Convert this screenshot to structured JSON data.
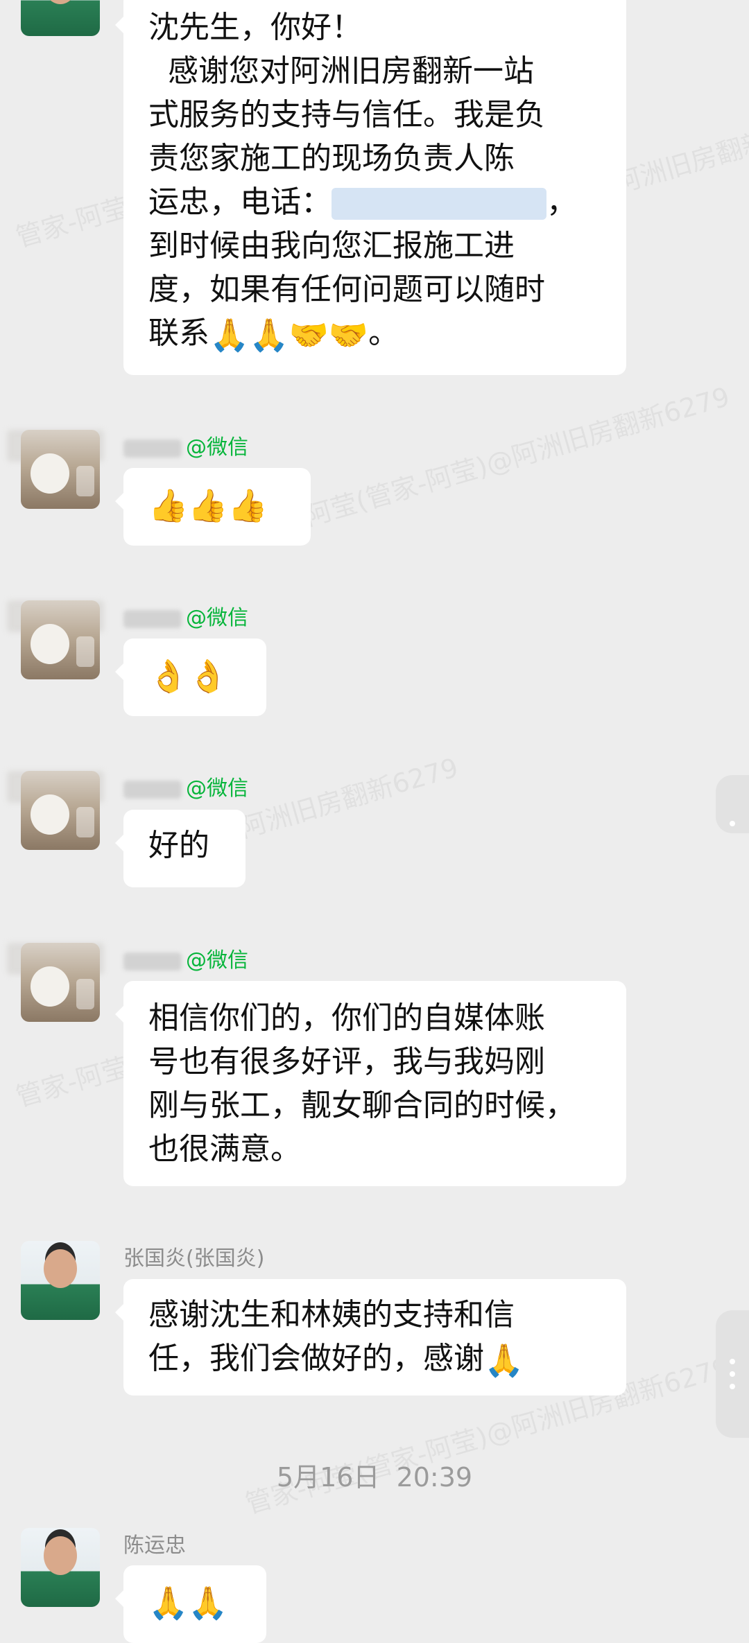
{
  "watermark_text": "管家-阿莹(管家-阿莹)@阿洲旧房翻新6279",
  "watermark_short": "管家-阿莹",
  "watermark_short2": "阿洲旧房翻新6279",
  "messages": {
    "m1": {
      "lines": [
        "沈先生，你好！",
        "  感谢您对阿洲旧房翻新一站",
        "式服务的支持与信任。我是负",
        "责您家施工的现场负责人陈",
        "运忠，电话：",
        "到时候由我向您汇报施工进",
        "度，如果有任何问题可以随时",
        "联系"
      ],
      "comma": "，",
      "tail": "。",
      "emojis": [
        "🙏",
        "🙏",
        "🤝",
        "🤝"
      ]
    },
    "m2": {
      "sender_suffix": "@微信",
      "emojis": [
        "👍",
        "👍",
        "👍"
      ]
    },
    "m3": {
      "sender_suffix": "@微信",
      "emojis": [
        "👌",
        "👌"
      ]
    },
    "m4": {
      "sender_suffix": "@微信",
      "text": "好的"
    },
    "m5": {
      "sender_suffix": "@微信",
      "lines": [
        "相信你们的，你们的自媒体账",
        "号也有很多好评，我与我妈刚",
        "刚与张工，靓女聊合同的时候，",
        "也很满意。"
      ]
    },
    "m6": {
      "sender": "张国炎(张国炎)",
      "lines": [
        "感谢沈生和林姨的支持和信",
        "任，我们会做好的，感谢"
      ],
      "emojis": [
        "🙏"
      ]
    },
    "timestamp": "5月16日  20:39",
    "m7": {
      "sender": "陈运忠",
      "emojis": [
        "🙏",
        "🙏"
      ]
    }
  }
}
